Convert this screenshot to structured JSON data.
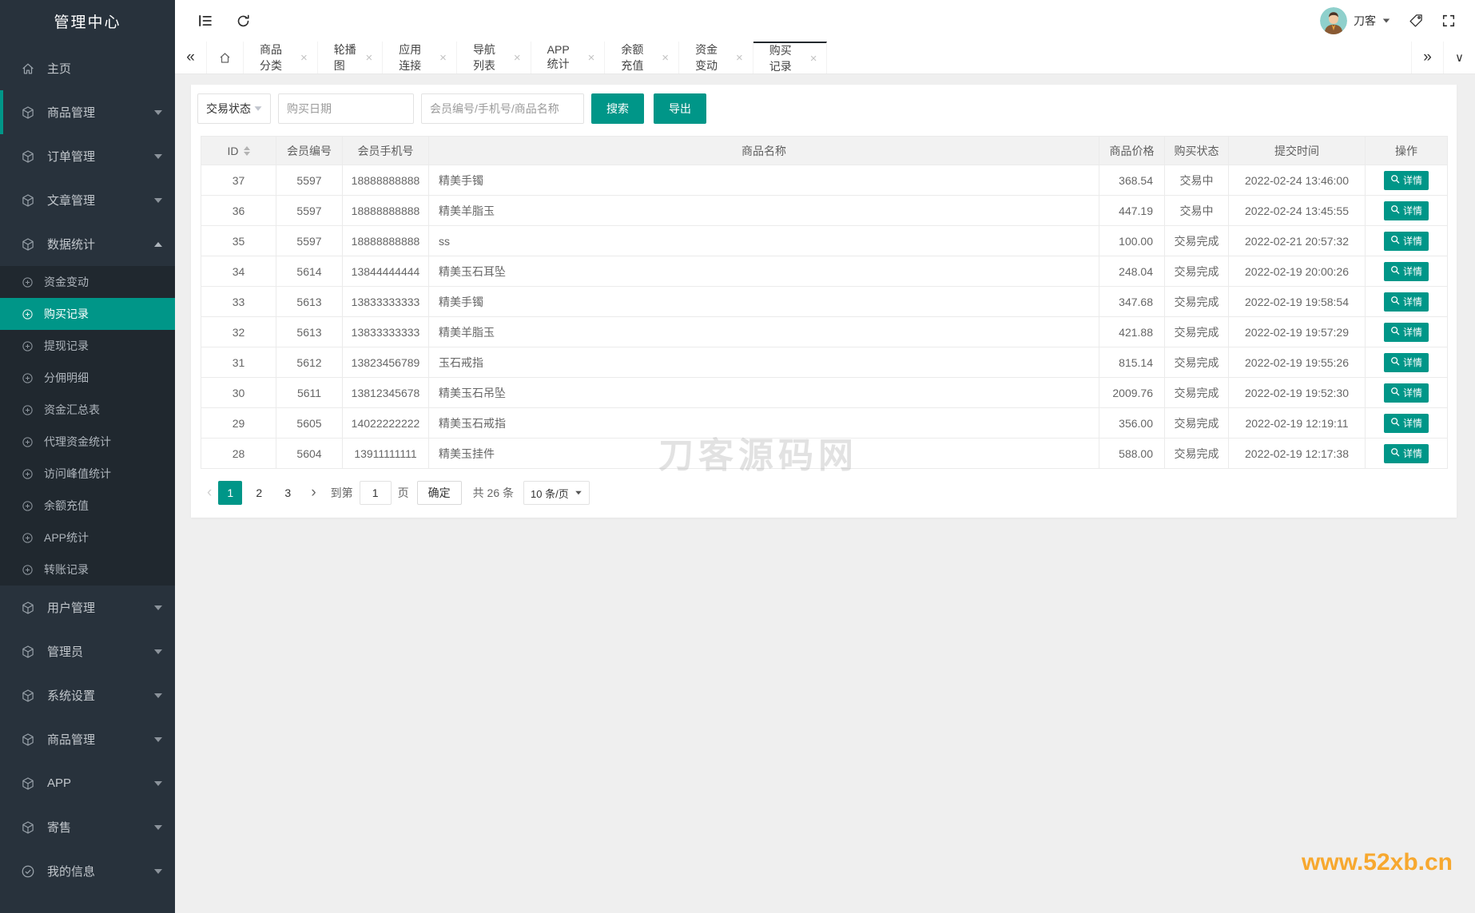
{
  "sidebar": {
    "title": "管理中心",
    "menu": [
      {
        "key": "home",
        "label": "主页",
        "icon": "home",
        "type": "item"
      },
      {
        "key": "goods-manage",
        "label": "商品管理",
        "icon": "cube",
        "type": "group",
        "accent": true
      },
      {
        "key": "order-manage",
        "label": "订单管理",
        "icon": "cube",
        "type": "group"
      },
      {
        "key": "article-manage",
        "label": "文章管理",
        "icon": "cube",
        "type": "group"
      },
      {
        "key": "data-stats",
        "label": "数据统计",
        "icon": "cube",
        "type": "group",
        "expanded": true,
        "children": [
          {
            "key": "funds-change",
            "label": "资金变动"
          },
          {
            "key": "purchase-records",
            "label": "购买记录",
            "active": true
          },
          {
            "key": "withdraw-records",
            "label": "提现记录"
          },
          {
            "key": "commission-detail",
            "label": "分佣明细"
          },
          {
            "key": "funds-summary",
            "label": "资金汇总表"
          },
          {
            "key": "agent-funds-stats",
            "label": "代理资金统计"
          },
          {
            "key": "visit-peak-stats",
            "label": "访问峰值统计"
          },
          {
            "key": "balance-recharge",
            "label": "余额充值"
          },
          {
            "key": "app-stats",
            "label": "APP统计"
          },
          {
            "key": "transfer-records",
            "label": "转账记录"
          }
        ]
      },
      {
        "key": "user-manage",
        "label": "用户管理",
        "icon": "cube",
        "type": "group"
      },
      {
        "key": "admins",
        "label": "管理员",
        "icon": "cube",
        "type": "group"
      },
      {
        "key": "system-settings",
        "label": "系统设置",
        "icon": "cube",
        "type": "group"
      },
      {
        "key": "goods-manage-2",
        "label": "商品管理",
        "icon": "cube",
        "type": "group"
      },
      {
        "key": "app",
        "label": "APP",
        "icon": "cube",
        "type": "group"
      },
      {
        "key": "consignment",
        "label": "寄售",
        "icon": "cube",
        "type": "group"
      },
      {
        "key": "my-info",
        "label": "我的信息",
        "icon": "circle-check",
        "type": "group"
      }
    ]
  },
  "header": {
    "user_name": "刀客"
  },
  "tabbar": {
    "tabs": [
      {
        "key": "goods-category",
        "label": "商品分类"
      },
      {
        "key": "carousel",
        "label": "轮播图"
      },
      {
        "key": "app-link",
        "label": "应用连接"
      },
      {
        "key": "nav-list",
        "label": "导航列表"
      },
      {
        "key": "app-stats",
        "label": "APP统计"
      },
      {
        "key": "balance-recharge",
        "label": "余额充值"
      },
      {
        "key": "funds-change",
        "label": "资金变动"
      },
      {
        "key": "purchase-records",
        "label": "购买记录",
        "active": true
      }
    ]
  },
  "filters": {
    "status_label": "交易状态",
    "date_placeholder": "购买日期",
    "keyword_placeholder": "会员编号/手机号/商品名称",
    "search_label": "搜索",
    "export_label": "导出"
  },
  "table": {
    "columns": [
      "ID",
      "会员编号",
      "会员手机号",
      "商品名称",
      "商品价格",
      "购买状态",
      "提交时间",
      "操作"
    ],
    "action_label": "详情",
    "rows": [
      {
        "id": "37",
        "member_no": "5597",
        "phone": "18888888888",
        "product": "精美手镯",
        "price": "368.54",
        "status": "交易中",
        "time": "2022-02-24 13:46:00"
      },
      {
        "id": "36",
        "member_no": "5597",
        "phone": "18888888888",
        "product": "精美羊脂玉",
        "price": "447.19",
        "status": "交易中",
        "time": "2022-02-24 13:45:55"
      },
      {
        "id": "35",
        "member_no": "5597",
        "phone": "18888888888",
        "product": "ss",
        "price": "100.00",
        "status": "交易完成",
        "time": "2022-02-21 20:57:32"
      },
      {
        "id": "34",
        "member_no": "5614",
        "phone": "13844444444",
        "product": "精美玉石耳坠",
        "price": "248.04",
        "status": "交易完成",
        "time": "2022-02-19 20:00:26"
      },
      {
        "id": "33",
        "member_no": "5613",
        "phone": "13833333333",
        "product": "精美手镯",
        "price": "347.68",
        "status": "交易完成",
        "time": "2022-02-19 19:58:54"
      },
      {
        "id": "32",
        "member_no": "5613",
        "phone": "13833333333",
        "product": "精美羊脂玉",
        "price": "421.88",
        "status": "交易完成",
        "time": "2022-02-19 19:57:29"
      },
      {
        "id": "31",
        "member_no": "5612",
        "phone": "13823456789",
        "product": "玉石戒指",
        "price": "815.14",
        "status": "交易完成",
        "time": "2022-02-19 19:55:26"
      },
      {
        "id": "30",
        "member_no": "5611",
        "phone": "13812345678",
        "product": "精美玉石吊坠",
        "price": "2009.76",
        "status": "交易完成",
        "time": "2022-02-19 19:52:30"
      },
      {
        "id": "29",
        "member_no": "5605",
        "phone": "14022222222",
        "product": "精美玉石戒指",
        "price": "356.00",
        "status": "交易完成",
        "time": "2022-02-19 12:19:11"
      },
      {
        "id": "28",
        "member_no": "5604",
        "phone": "13911111111",
        "product": "精美玉挂件",
        "price": "588.00",
        "status": "交易完成",
        "time": "2022-02-19 12:17:38"
      }
    ]
  },
  "pagination": {
    "prev_glyph": "‹",
    "next_glyph": "›",
    "pages": [
      "1",
      "2",
      "3"
    ],
    "active_page": "1",
    "goto_label": "到第",
    "goto_value": "1",
    "page_word": "页",
    "confirm_label": "确定",
    "total_text": "共 26 条",
    "per_page": "10 条/页"
  },
  "icons_glyphs": {
    "tabs_back": "«",
    "tabs_forward": "»",
    "tabs_menu": "∨"
  },
  "watermark_center": "刀客源码网",
  "watermark_corner": "www.52xb.cn",
  "colors": {
    "accent": "#009688",
    "sidebar_bg": "#28323c",
    "submenu_bg": "#20282f",
    "active_tab_border": "#23292e",
    "corner_watermark": "#f7a82f"
  }
}
